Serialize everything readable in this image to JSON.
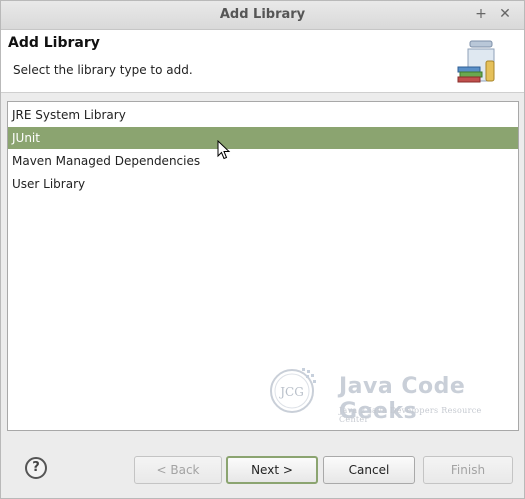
{
  "window": {
    "title": "Add Library"
  },
  "header": {
    "title": "Add Library",
    "subtitle": "Select the library type to add."
  },
  "library_types": [
    {
      "label": "JRE System Library",
      "selected": false
    },
    {
      "label": "JUnit",
      "selected": true
    },
    {
      "label": "Maven Managed Dependencies",
      "selected": false
    },
    {
      "label": "User Library",
      "selected": false
    }
  ],
  "watermark": {
    "logo_text": "JCG",
    "brand": "Java Code Geeks",
    "tagline": "Java 2 Java Developers Resource Center"
  },
  "buttons": {
    "help": "?",
    "back": "< Back",
    "next": "Next >",
    "cancel": "Cancel",
    "finish": "Finish"
  },
  "colors": {
    "selection": "#8ba470",
    "accent": "#8ba470"
  },
  "icons": {
    "pin": "pin-icon",
    "close": "close-icon",
    "library": "library-jar-icon",
    "cursor": "mouse-cursor-icon"
  }
}
